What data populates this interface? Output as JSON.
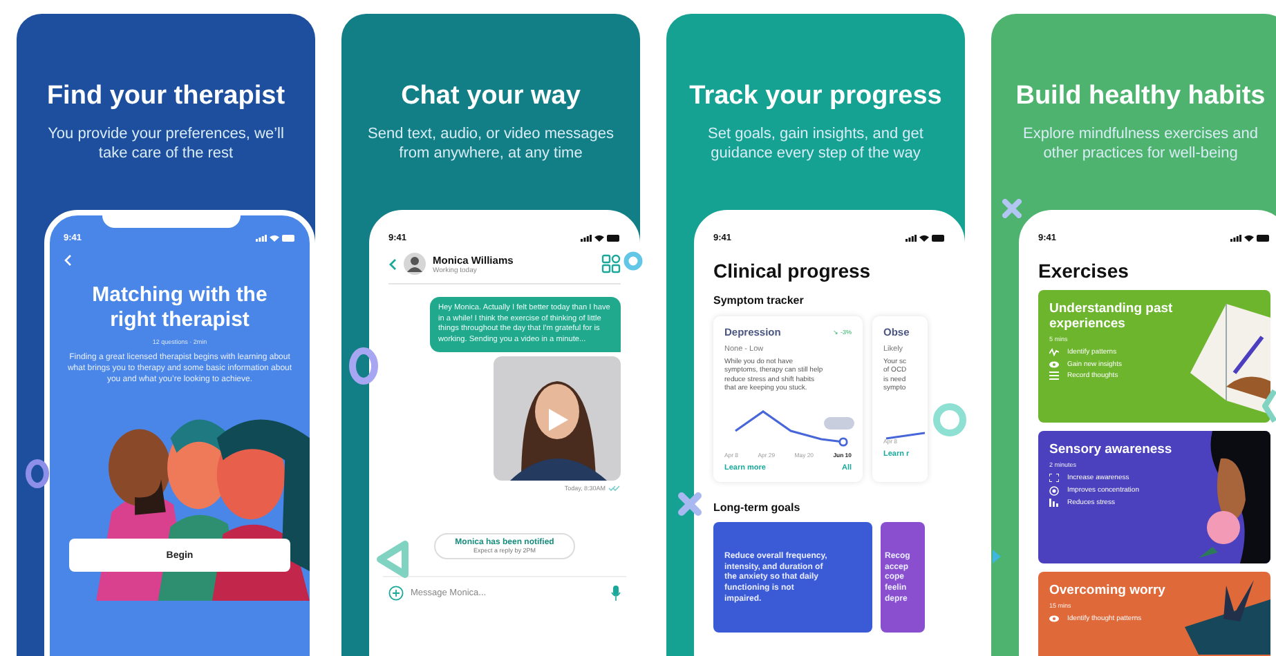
{
  "panels": [
    {
      "kind": "matching",
      "color": "#1d4f9e",
      "title": "Find your therapist",
      "subtitle": "You provide your preferences, we’ll take care of the rest",
      "screen": {
        "time": "9:41",
        "heading": "Matching with the right therapist",
        "meta": "12 questions · 2min",
        "body": "Finding a great licensed therapist begins with learning about what brings you to therapy and some basic information about you and what you’re looking to achieve.",
        "button": "Begin"
      }
    },
    {
      "kind": "chat",
      "color": "#127f86",
      "title": "Chat your way",
      "subtitle": "Send text, audio, or video messages from anywhere, at any time",
      "screen": {
        "time": "9:41",
        "contact": "Monica Williams",
        "contact_status": "Working today",
        "message": "Hey Monica. Actually I felt better today than I have in a while! I think the exercise of thinking of little things throughout the day that I'm grateful for is working. Sending you a video in a minute...",
        "timestamp": "Today, 8:30AM",
        "notice": "Monica has been notified",
        "notice_sub": "Expect a reply by 2PM",
        "placeholder": "Message Monica..."
      }
    },
    {
      "kind": "progress",
      "color": "#15a293",
      "title": "Track your progress",
      "subtitle": "Set goals, gain insights, and get guidance every step of the way",
      "screen": {
        "time": "9:41",
        "heading": "Clinical progress",
        "section": "Symptom tracker",
        "trackers": [
          {
            "name": "Depression",
            "change": "↘ -3%",
            "range": "None - Low",
            "lines": [
              "While you do not have",
              "symptoms, therapy can still help",
              "reduce stress and shift habits",
              "that are keeping you stuck."
            ],
            "dates": [
              "Apr 8",
              "Apr 29",
              "May 20",
              "Jun 10"
            ],
            "link": "Learn more",
            "all": "All"
          },
          {
            "name": "Obse",
            "range": "Likely",
            "lines": [
              "Your sc",
              "of OCD",
              "is need",
              "sympto"
            ],
            "dates": [
              "Apr 8"
            ],
            "link": "Learn r"
          }
        ],
        "goals_label": "Long-term goals",
        "goals": [
          {
            "color": "#3b5bd6",
            "lines": [
              "Reduce overall frequency,",
              "intensity, and duration of",
              "the anxiety so that daily",
              "functioning is not",
              "impaired."
            ]
          },
          {
            "color": "#8a4fcf",
            "lines": [
              "Recog",
              "accep",
              "cope",
              "feelin",
              "depre"
            ]
          }
        ]
      }
    },
    {
      "kind": "exercises",
      "color": "#4db36e",
      "title": "Build healthy habits",
      "subtitle": "Explore mindfulness exercises and other practices for well-being",
      "screen": {
        "time": "9:41",
        "heading": "Exercises",
        "cards": [
          {
            "title": "Understanding past experiences",
            "duration": "5 mins",
            "color": "#6db52d",
            "items": [
              {
                "kind": "pulse",
                "text": "Identify patterns"
              },
              {
                "kind": "eye",
                "text": "Gain new insights"
              },
              {
                "kind": "list",
                "text": "Record thoughts"
              }
            ]
          },
          {
            "title": "Sensory awareness",
            "duration": "2 minutes",
            "color": "#4b40be",
            "items": [
              {
                "kind": "frame",
                "text": "Increase awareness"
              },
              {
                "kind": "target",
                "text": "Improves concentration"
              },
              {
                "kind": "bars",
                "text": "Reduces stress"
              }
            ]
          },
          {
            "title": "Overcoming worry",
            "duration": "15 mins",
            "color": "#e0693a",
            "items": [
              {
                "kind": "eye",
                "text": "Identify thought patterns"
              }
            ]
          }
        ]
      }
    }
  ]
}
